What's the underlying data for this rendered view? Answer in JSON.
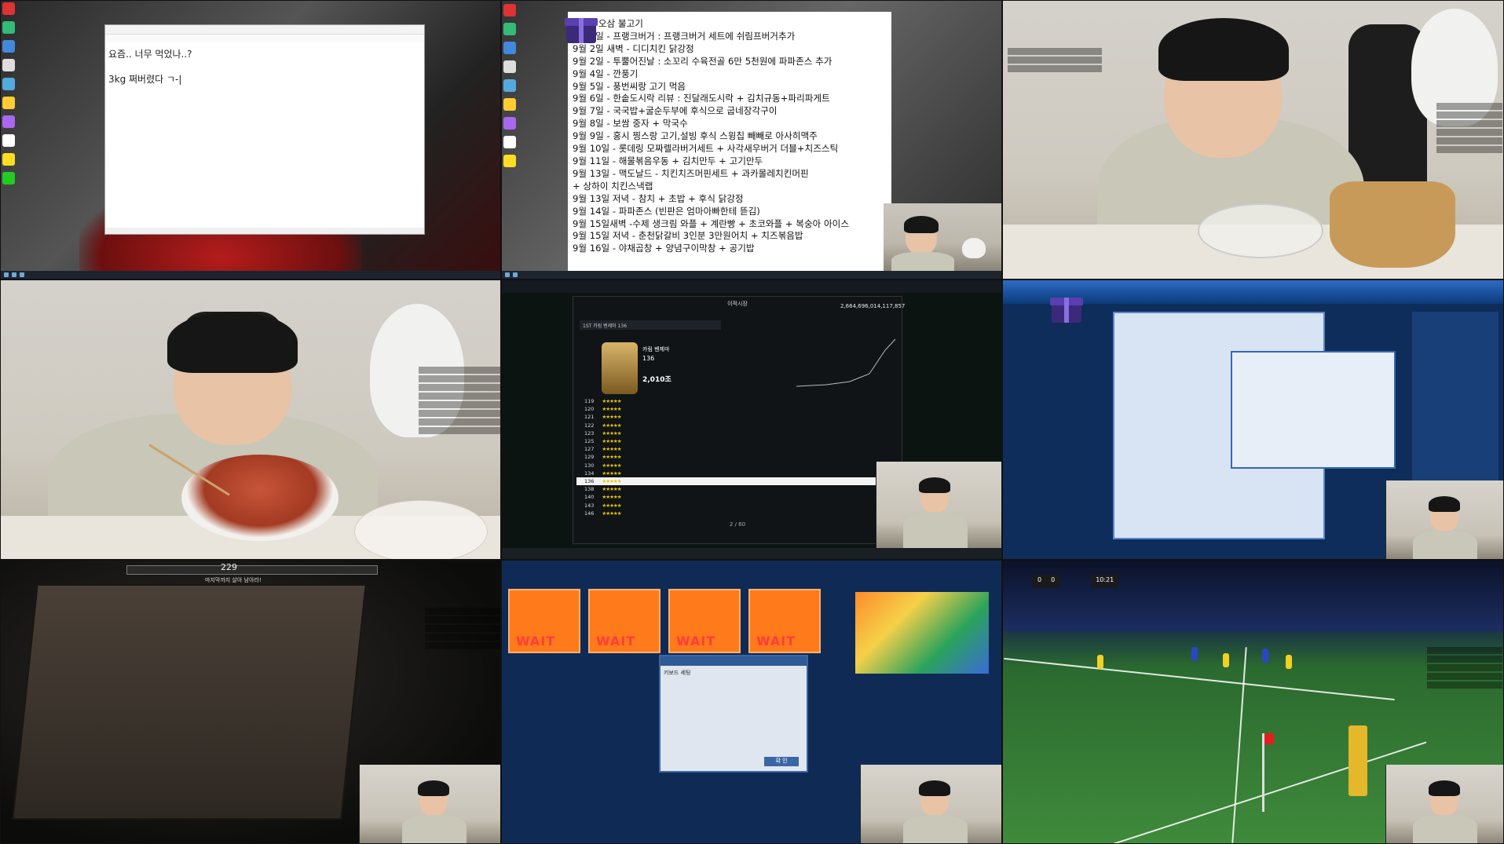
{
  "notepad": {
    "line1": "요즘.. 너무 먹었나..?",
    "line2": "3kg 쩌버렸다 ㄱ-|"
  },
  "food_list": {
    "items": [
      "- 엄준 오삼 불고기",
      "9월 1일 - 프랭크버거 : 프랭크버거 세트에 쉬림프버거추가",
      "9월 2일 새벽 - 디디치킨 닭강정",
      "9월 2일 - 투뿔어진날 : 소꼬리 수육전골 6만 5천원에 파파존스 추가",
      "9월 4일 - 깐풍기",
      "9월 5일 - 풍번씨랑 고기 먹음",
      "9월 6일 - 한솥도시락 리뷰 : 진달래도시락 + 김치규동+파리파게트",
      "9월 7일 - 국국밥+굴순두부에 후식으로 굽네장각구이",
      "9월 8일 - 보쌈 중자 + 막국수",
      "9월 9일 - 홍시 찡스랑 고기,설빙 후식 스윙칩 빼빼로 아사히맥주",
      "9월 10일 - 롯데링 모짜렐라버거세트 + 사각새우버거 더블+치즈스틱",
      "9월 11일 - 해물볶음우동 + 김치만두 + 고기만두",
      "9월 13일 - 맥도날드 - 치킨치즈머핀세트 + 과카몰레치킨머핀",
      "+ 상하이 치킨스낵랩",
      "9월 13일 저녁 - 참치 + 초밥 + 후식 닭강정",
      "9월 14일 - 파파존스 (빈판은 엄마아빠한테 뜯김)",
      "9월 15일새벽 -수제 생크림 와플 + 계란빵 + 초코와플 + 복숭아 아이스",
      "9월 15일 저녁 - 춘천닭갈비 3인분 3만원어치 + 치즈볶음밥",
      "9월 16일 - 야채곱창 + 양념구이막창 + 공기밥"
    ]
  },
  "market": {
    "title": "이적시장",
    "player_name": "카림 벤제마",
    "price_big": "2,664,696,014,117,857",
    "price_card": "2,010조",
    "level": "136",
    "rows": [
      {
        "lv": "119"
      },
      {
        "lv": "120"
      },
      {
        "lv": "121"
      },
      {
        "lv": "122"
      },
      {
        "lv": "123"
      },
      {
        "lv": "125"
      },
      {
        "lv": "127"
      },
      {
        "lv": "129"
      },
      {
        "lv": "130"
      },
      {
        "lv": "134"
      },
      {
        "lv": "136"
      },
      {
        "lv": "138"
      },
      {
        "lv": "140"
      },
      {
        "lv": "143"
      },
      {
        "lv": "146"
      }
    ],
    "stars": "★★★★★",
    "pager": "2 / 60",
    "list_entry": "1ST  카림 벤제마  136"
  },
  "dungeon": {
    "round": "229",
    "subtitle": "마지막까지 살아 남아라!"
  },
  "party": {
    "wait_label": "WAIT",
    "dialog_title": "키보드 세팅",
    "dialog_button": "확 인"
  },
  "football": {
    "home_score": "0",
    "away_score": "0",
    "clock": "10:21"
  },
  "colors": {
    "notepad_bg": "#ffffff",
    "slot_orange": "#ff7a1a",
    "pitch_green": "#3f8a3b",
    "fc_gold": "#e7c600"
  }
}
